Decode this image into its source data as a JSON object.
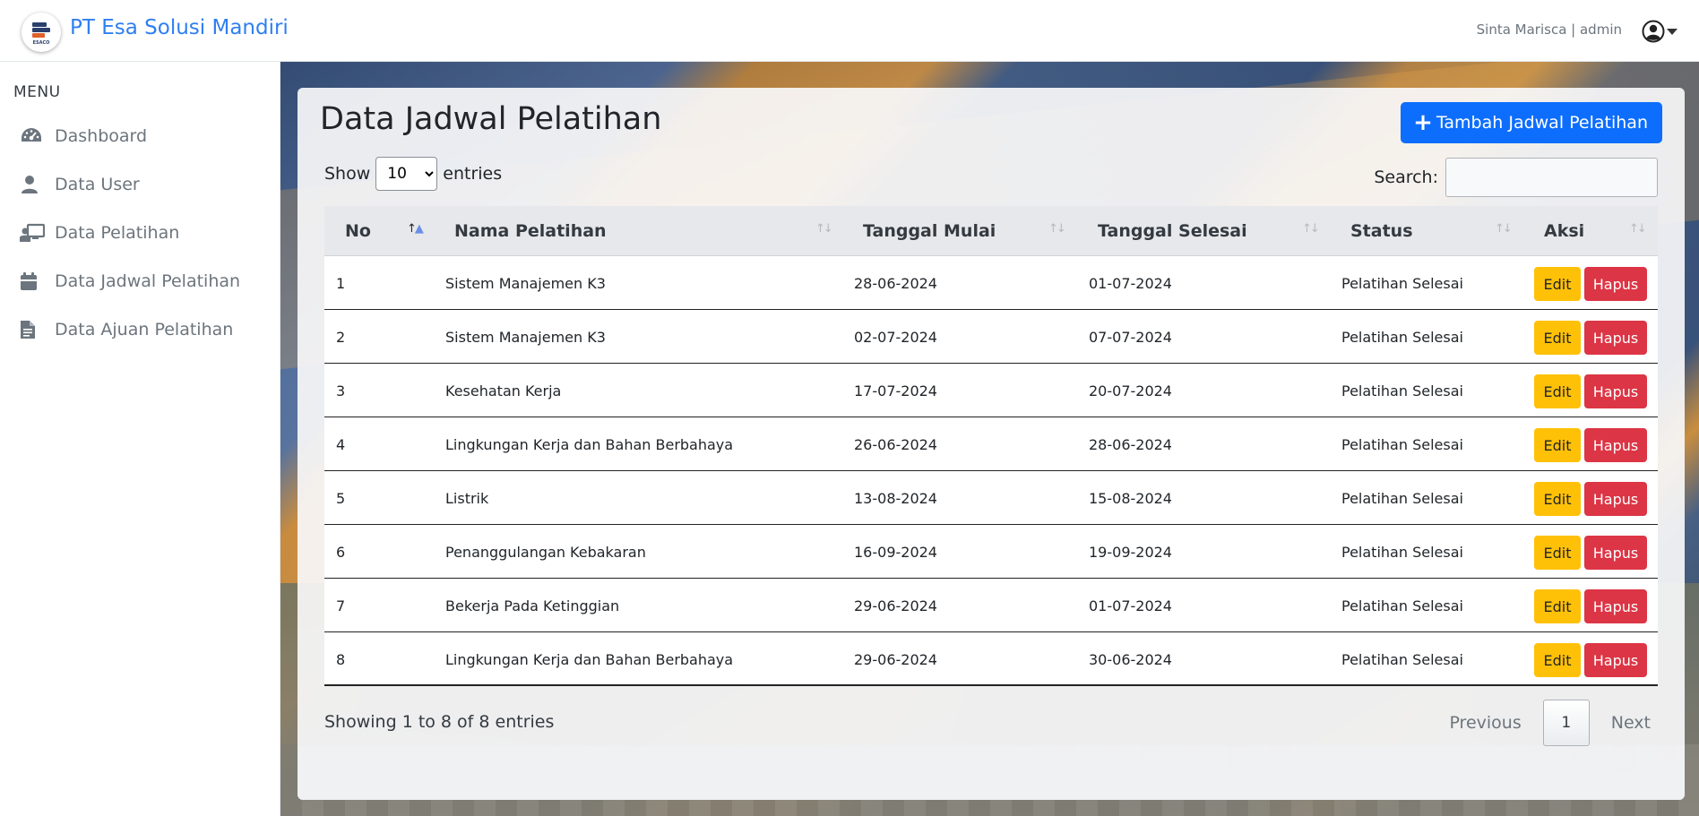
{
  "navbar": {
    "brand_name": "PT Esa Solusi Mandiri",
    "logo_text": "ESACO",
    "user_label": "Sinta Marisca | admin",
    "user_icon": "user-circle-icon"
  },
  "sidebar": {
    "menu_title": "MENU",
    "items": [
      {
        "label": "Dashboard",
        "icon": "gauge-icon"
      },
      {
        "label": "Data User",
        "icon": "user-icon"
      },
      {
        "label": "Data Pelatihan",
        "icon": "chalkboard-teacher-icon"
      },
      {
        "label": "Data Jadwal Pelatihan",
        "icon": "calendar-icon"
      },
      {
        "label": "Data Ajuan Pelatihan",
        "icon": "file-text-icon"
      }
    ]
  },
  "main": {
    "title": "Data Jadwal Pelatihan",
    "add_button": "Tambah Jadwal Pelatihan",
    "show_label": "Show",
    "entries_label": "entries",
    "entries_value": "10",
    "search_label": "Search:",
    "search_value": "",
    "columns": [
      "No",
      "Nama Pelatihan",
      "Tanggal Mulai",
      "Tanggal Selesai",
      "Status",
      "Aksi"
    ],
    "rows": [
      {
        "no": "1",
        "nama": "Sistem Manajemen K3",
        "mulai": "28-06-2024",
        "selesai": "01-07-2024",
        "status": "Pelatihan Selesai"
      },
      {
        "no": "2",
        "nama": "Sistem Manajemen K3",
        "mulai": "02-07-2024",
        "selesai": "07-07-2024",
        "status": "Pelatihan Selesai"
      },
      {
        "no": "3",
        "nama": "Kesehatan Kerja",
        "mulai": "17-07-2024",
        "selesai": "20-07-2024",
        "status": "Pelatihan Selesai"
      },
      {
        "no": "4",
        "nama": "Lingkungan Kerja dan Bahan Berbahaya",
        "mulai": "26-06-2024",
        "selesai": "28-06-2024",
        "status": "Pelatihan Selesai"
      },
      {
        "no": "5",
        "nama": "Listrik",
        "mulai": "13-08-2024",
        "selesai": "15-08-2024",
        "status": "Pelatihan Selesai"
      },
      {
        "no": "6",
        "nama": "Penanggulangan Kebakaran",
        "mulai": "16-09-2024",
        "selesai": "19-09-2024",
        "status": "Pelatihan Selesai"
      },
      {
        "no": "7",
        "nama": "Bekerja Pada Ketinggian",
        "mulai": "29-06-2024",
        "selesai": "01-07-2024",
        "status": "Pelatihan Selesai"
      },
      {
        "no": "8",
        "nama": "Lingkungan Kerja dan Bahan Berbahaya",
        "mulai": "29-06-2024",
        "selesai": "30-06-2024",
        "status": "Pelatihan Selesai"
      }
    ],
    "edit_label": "Edit",
    "delete_label": "Hapus",
    "footer_info": "Showing 1 to 8 of 8 entries",
    "pagination": {
      "previous": "Previous",
      "current": "1",
      "next": "Next"
    }
  },
  "colors": {
    "primary": "#0d6efd",
    "brand": "#2f7ff0",
    "edit": "#ffc107",
    "delete": "#dc3545"
  }
}
